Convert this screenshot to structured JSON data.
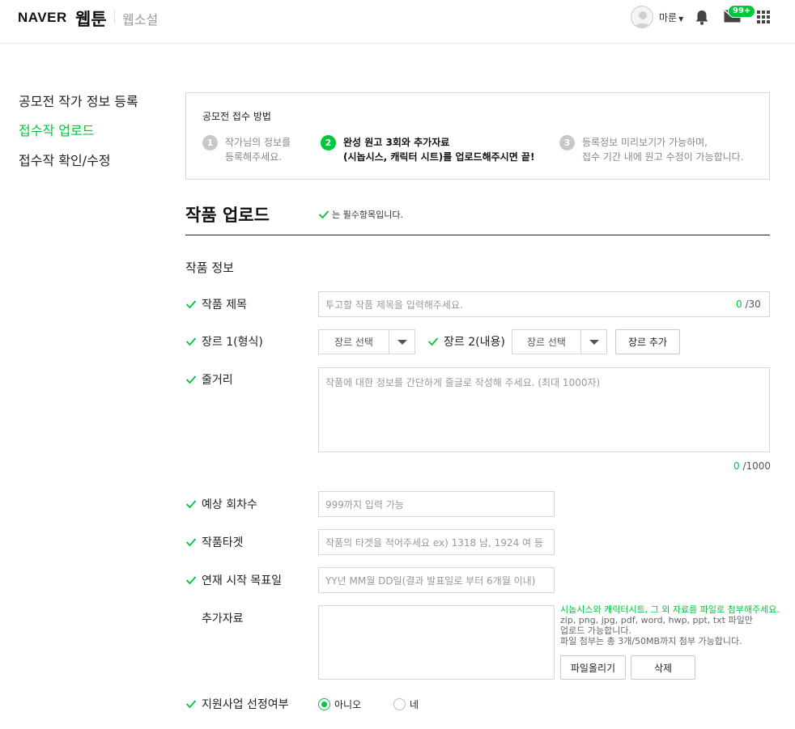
{
  "header": {
    "brand": "NAVER",
    "service": "웹툰",
    "sub_service": "웹소설",
    "user_name": "마룬",
    "mail_badge": "99+"
  },
  "sidebar": {
    "items": [
      {
        "label": "공모전 작가 정보 등록",
        "active": false
      },
      {
        "label": "접수작 업로드",
        "active": true
      },
      {
        "label": "접수작 확인/수정",
        "active": false
      }
    ]
  },
  "steps": {
    "title": "공모전 접수 방법",
    "items": [
      {
        "num": "1",
        "line1": "작가님의 정보를",
        "line2": "등록해주세요.",
        "active": false
      },
      {
        "num": "2",
        "line1": "완성 원고 3회와 추가자료",
        "line2": "(시놉시스, 캐릭터 시트)를 업로드해주시면 끝!",
        "active": true
      },
      {
        "num": "3",
        "line1": "등록정보 미리보기가 가능하며,",
        "line2": "접수 기간 내에 원고 수정이 가능합니다.",
        "active": false
      }
    ]
  },
  "form": {
    "title": "작품 업로드",
    "required_note": "는 필수항목입니다.",
    "section_title": "작품 정보",
    "work_title": {
      "label": "작품 제목",
      "placeholder": "투고할 작품 제목을 입력해주세요.",
      "count": "0",
      "max": " /30"
    },
    "genre1": {
      "label": "장르 1(형식)",
      "select": "장르 선택"
    },
    "genre2": {
      "label": "장르 2(내용)",
      "select": "장르 선택"
    },
    "genre_add": "장르 추가",
    "synopsis": {
      "label": "줄거리",
      "placeholder": "작품에 대한 정보를 간단하게 줄글로 작성해 주세요. (최대 1000자)",
      "count": "0",
      "max": " /1000"
    },
    "episodes": {
      "label": "예상 회차수",
      "placeholder": "999까지 입력 가능"
    },
    "target": {
      "label": "작품타겟",
      "placeholder": "작품의 타겟을 적어주세요 ex) 1318 남, 1924 여 등"
    },
    "start_date": {
      "label": "연재 시작 목표일",
      "placeholder": "YY년 MM월 DD일(결과 발표일로 부터 6개월 이내)"
    },
    "attachments": {
      "label": "추가자료",
      "note_green": "시놉시스와 캐릭터시트, 그 외 자료를 파일로 첨부해주세요.",
      "note_formats_1": "zip, png, jpg, pdf, word, hwp, ppt, txt 파일만",
      "note_formats_2": "업로드 가능합니다.",
      "note_limit": "파일 첨부는 총 3개/50MB까지 첨부 가능합니다.",
      "upload_button": "파일올리기",
      "delete_button": "삭제"
    },
    "support": {
      "label": "지원사업 선정여부",
      "option_no": "아니오",
      "option_yes": "네",
      "selected": "아니오"
    }
  },
  "colors": {
    "accent": "#00c73c",
    "border": "#d6d6d6"
  }
}
